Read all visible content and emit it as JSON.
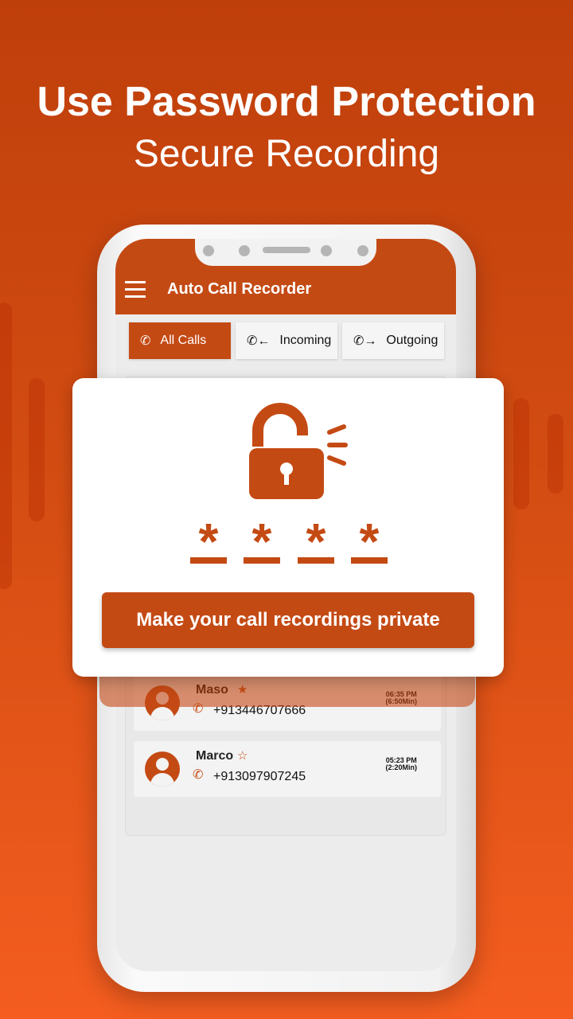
{
  "promo": {
    "title": "Use Password Protection",
    "subtitle": "Secure Recording"
  },
  "app": {
    "title": "Auto Call Recorder"
  },
  "tabs": [
    {
      "label": "All Calls",
      "active": true
    },
    {
      "label": "Incoming"
    },
    {
      "label": "Outgoing"
    }
  ],
  "calls": [
    {
      "name": "Maso",
      "number": "+913446707666",
      "time": "06:35 PM",
      "duration": "(6:50Min)",
      "favorite": true,
      "direction": "incoming"
    },
    {
      "name": "Marco",
      "number": "+913097907245",
      "time": "05:23 PM",
      "duration": "(2:20Min)",
      "favorite": false,
      "direction": "outgoing"
    }
  ],
  "lock_card": {
    "pin_mask": [
      "*",
      "*",
      "*",
      "*"
    ],
    "button_label": "Make your call recordings private"
  },
  "colors": {
    "accent": "#c44a14",
    "background_top": "#bf3f0b",
    "background_bottom": "#f45d1f"
  }
}
